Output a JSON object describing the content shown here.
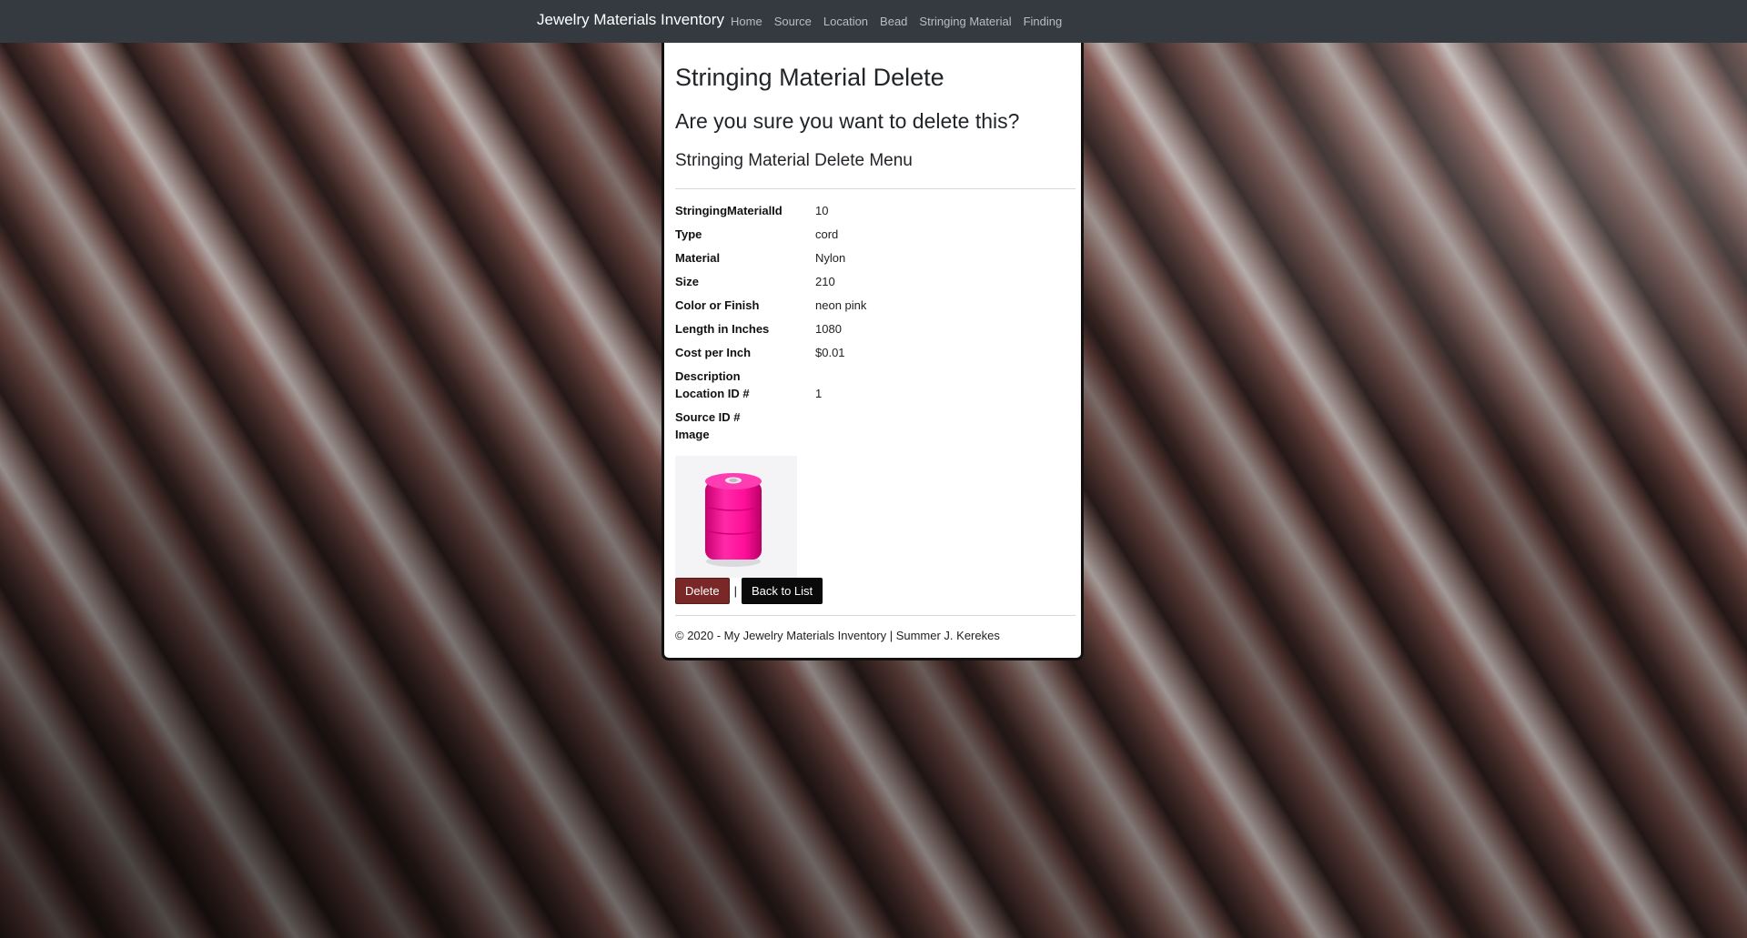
{
  "navbar": {
    "brand": "Jewelry Materials Inventory",
    "links": [
      "Home",
      "Source",
      "Location",
      "Bead",
      "Stringing Material",
      "Finding"
    ]
  },
  "page": {
    "title": "Stringing Material Delete",
    "confirm": "Are you sure you want to delete this?",
    "subtitle": "Stringing Material Delete Menu"
  },
  "details": [
    {
      "label": "StringingMaterialId",
      "value": "10"
    },
    {
      "label": "Type",
      "value": "cord"
    },
    {
      "label": "Material",
      "value": "Nylon"
    },
    {
      "label": "Size",
      "value": "210"
    },
    {
      "label": "Color or Finish",
      "value": "neon pink"
    },
    {
      "label": "Length in Inches",
      "value": "1080"
    },
    {
      "label": "Cost per Inch",
      "value": "$0.01"
    },
    {
      "label": "Description",
      "value": ""
    },
    {
      "label": "Location ID #",
      "value": "1"
    },
    {
      "label": "Source ID #",
      "value": ""
    },
    {
      "label": "Image",
      "value": ""
    }
  ],
  "image": {
    "icon": "thread-spool-image",
    "color": "#ff1aa3"
  },
  "actions": {
    "delete_label": "Delete",
    "separator": "|",
    "back_label": "Back to List"
  },
  "footer": {
    "text": "© 2020 - My Jewelry Materials Inventory | Summer J. Kerekes"
  },
  "colors": {
    "navbar": "#343a40",
    "delete": "#7a2727",
    "back": "#0a0a0a"
  }
}
